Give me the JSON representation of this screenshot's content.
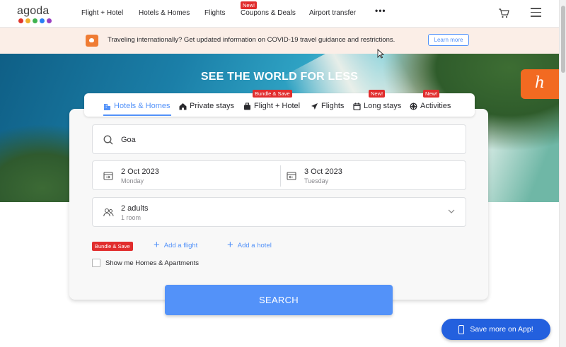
{
  "header": {
    "logo": "agoda",
    "logo_dots": [
      "#e0362c",
      "#f0b12c",
      "#3fb34f",
      "#2a7ff5",
      "#9a3fc2"
    ],
    "nav": [
      {
        "label": "Flight + Hotel"
      },
      {
        "label": "Hotels & Homes"
      },
      {
        "label": "Flights"
      },
      {
        "label": "Coupons & Deals",
        "badge": "New!"
      },
      {
        "label": "Airport transfer"
      }
    ],
    "more": "•••",
    "icons": {
      "cart": "cart-icon",
      "menu": "hamburger-menu-icon"
    }
  },
  "banner": {
    "text": "Traveling internationally? Get updated information on COVID-19 travel guidance and restrictions.",
    "button": "Learn more"
  },
  "hero": {
    "title": "SEE THE WORLD FOR LESS",
    "extension_glyph": "h"
  },
  "tabs": [
    {
      "label": "Hotels & Homes",
      "active": true,
      "icon": "building-icon"
    },
    {
      "label": "Private stays",
      "icon": "house-icon"
    },
    {
      "label": "Flight + Hotel",
      "badge": "Bundle & Save",
      "icon": "suitcase-icon"
    },
    {
      "label": "Flights",
      "icon": "plane-icon"
    },
    {
      "label": "Long stays",
      "badge": "New!",
      "icon": "calendar-icon"
    },
    {
      "label": "Activities",
      "badge": "New!",
      "icon": "activities-icon"
    }
  ],
  "search": {
    "destination": "Goa",
    "checkin": {
      "date": "2 Oct 2023",
      "day": "Monday"
    },
    "checkout": {
      "date": "3 Oct 2023",
      "day": "Tuesday"
    },
    "guests": {
      "main": "2 adults",
      "sub": "1 room"
    },
    "bundle_badge": "Bundle & Save",
    "add_flight": "Add a flight",
    "add_hotel": "Add a hotel",
    "homes_checkbox": "Show me Homes & Apartments",
    "search_button": "SEARCH"
  },
  "app_button": "Save more on App!",
  "colors": {
    "accent": "#5392f9",
    "badge": "#e12d2d",
    "app_button": "#2360de"
  }
}
